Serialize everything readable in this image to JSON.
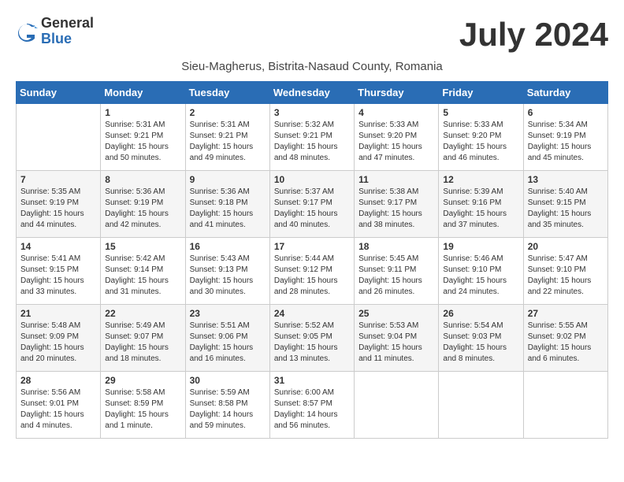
{
  "logo": {
    "general": "General",
    "blue": "Blue"
  },
  "title": "July 2024",
  "subtitle": "Sieu-Magherus, Bistrita-Nasaud County, Romania",
  "days_header": [
    "Sunday",
    "Monday",
    "Tuesday",
    "Wednesday",
    "Thursday",
    "Friday",
    "Saturday"
  ],
  "weeks": [
    [
      {
        "day": "",
        "info": ""
      },
      {
        "day": "1",
        "info": "Sunrise: 5:31 AM\nSunset: 9:21 PM\nDaylight: 15 hours\nand 50 minutes."
      },
      {
        "day": "2",
        "info": "Sunrise: 5:31 AM\nSunset: 9:21 PM\nDaylight: 15 hours\nand 49 minutes."
      },
      {
        "day": "3",
        "info": "Sunrise: 5:32 AM\nSunset: 9:21 PM\nDaylight: 15 hours\nand 48 minutes."
      },
      {
        "day": "4",
        "info": "Sunrise: 5:33 AM\nSunset: 9:20 PM\nDaylight: 15 hours\nand 47 minutes."
      },
      {
        "day": "5",
        "info": "Sunrise: 5:33 AM\nSunset: 9:20 PM\nDaylight: 15 hours\nand 46 minutes."
      },
      {
        "day": "6",
        "info": "Sunrise: 5:34 AM\nSunset: 9:19 PM\nDaylight: 15 hours\nand 45 minutes."
      }
    ],
    [
      {
        "day": "7",
        "info": "Sunrise: 5:35 AM\nSunset: 9:19 PM\nDaylight: 15 hours\nand 44 minutes."
      },
      {
        "day": "8",
        "info": "Sunrise: 5:36 AM\nSunset: 9:19 PM\nDaylight: 15 hours\nand 42 minutes."
      },
      {
        "day": "9",
        "info": "Sunrise: 5:36 AM\nSunset: 9:18 PM\nDaylight: 15 hours\nand 41 minutes."
      },
      {
        "day": "10",
        "info": "Sunrise: 5:37 AM\nSunset: 9:17 PM\nDaylight: 15 hours\nand 40 minutes."
      },
      {
        "day": "11",
        "info": "Sunrise: 5:38 AM\nSunset: 9:17 PM\nDaylight: 15 hours\nand 38 minutes."
      },
      {
        "day": "12",
        "info": "Sunrise: 5:39 AM\nSunset: 9:16 PM\nDaylight: 15 hours\nand 37 minutes."
      },
      {
        "day": "13",
        "info": "Sunrise: 5:40 AM\nSunset: 9:15 PM\nDaylight: 15 hours\nand 35 minutes."
      }
    ],
    [
      {
        "day": "14",
        "info": "Sunrise: 5:41 AM\nSunset: 9:15 PM\nDaylight: 15 hours\nand 33 minutes."
      },
      {
        "day": "15",
        "info": "Sunrise: 5:42 AM\nSunset: 9:14 PM\nDaylight: 15 hours\nand 31 minutes."
      },
      {
        "day": "16",
        "info": "Sunrise: 5:43 AM\nSunset: 9:13 PM\nDaylight: 15 hours\nand 30 minutes."
      },
      {
        "day": "17",
        "info": "Sunrise: 5:44 AM\nSunset: 9:12 PM\nDaylight: 15 hours\nand 28 minutes."
      },
      {
        "day": "18",
        "info": "Sunrise: 5:45 AM\nSunset: 9:11 PM\nDaylight: 15 hours\nand 26 minutes."
      },
      {
        "day": "19",
        "info": "Sunrise: 5:46 AM\nSunset: 9:10 PM\nDaylight: 15 hours\nand 24 minutes."
      },
      {
        "day": "20",
        "info": "Sunrise: 5:47 AM\nSunset: 9:10 PM\nDaylight: 15 hours\nand 22 minutes."
      }
    ],
    [
      {
        "day": "21",
        "info": "Sunrise: 5:48 AM\nSunset: 9:09 PM\nDaylight: 15 hours\nand 20 minutes."
      },
      {
        "day": "22",
        "info": "Sunrise: 5:49 AM\nSunset: 9:07 PM\nDaylight: 15 hours\nand 18 minutes."
      },
      {
        "day": "23",
        "info": "Sunrise: 5:51 AM\nSunset: 9:06 PM\nDaylight: 15 hours\nand 16 minutes."
      },
      {
        "day": "24",
        "info": "Sunrise: 5:52 AM\nSunset: 9:05 PM\nDaylight: 15 hours\nand 13 minutes."
      },
      {
        "day": "25",
        "info": "Sunrise: 5:53 AM\nSunset: 9:04 PM\nDaylight: 15 hours\nand 11 minutes."
      },
      {
        "day": "26",
        "info": "Sunrise: 5:54 AM\nSunset: 9:03 PM\nDaylight: 15 hours\nand 8 minutes."
      },
      {
        "day": "27",
        "info": "Sunrise: 5:55 AM\nSunset: 9:02 PM\nDaylight: 15 hours\nand 6 minutes."
      }
    ],
    [
      {
        "day": "28",
        "info": "Sunrise: 5:56 AM\nSunset: 9:01 PM\nDaylight: 15 hours\nand 4 minutes."
      },
      {
        "day": "29",
        "info": "Sunrise: 5:58 AM\nSunset: 8:59 PM\nDaylight: 15 hours\nand 1 minute."
      },
      {
        "day": "30",
        "info": "Sunrise: 5:59 AM\nSunset: 8:58 PM\nDaylight: 14 hours\nand 59 minutes."
      },
      {
        "day": "31",
        "info": "Sunrise: 6:00 AM\nSunset: 8:57 PM\nDaylight: 14 hours\nand 56 minutes."
      },
      {
        "day": "",
        "info": ""
      },
      {
        "day": "",
        "info": ""
      },
      {
        "day": "",
        "info": ""
      }
    ]
  ]
}
